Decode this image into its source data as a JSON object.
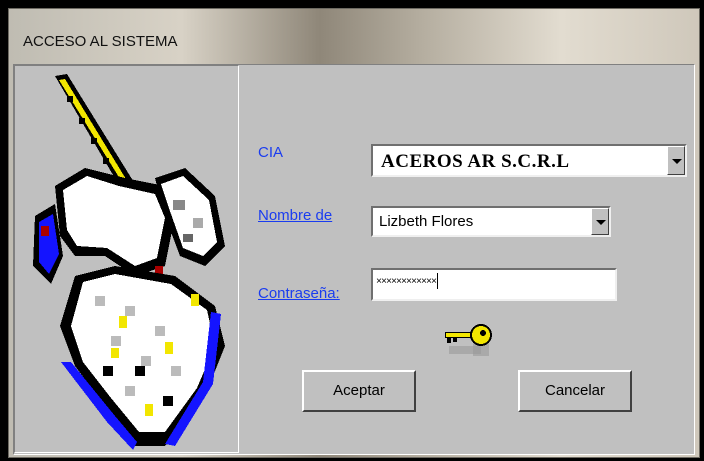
{
  "window": {
    "title": "ACCESO AL SISTEMA"
  },
  "form": {
    "cia_label": "CIA",
    "cia_value": "ACEROS AR S.C.R.L",
    "user_label": "Nombre de",
    "user_value": "Lizbeth Flores",
    "password_label": "Contraseña:",
    "password_value": "××××××××××××"
  },
  "buttons": {
    "accept": "Aceptar",
    "cancel": "Cancelar"
  },
  "icons": {
    "logo": "unicorn-logo-icon",
    "key": "key-icon"
  }
}
